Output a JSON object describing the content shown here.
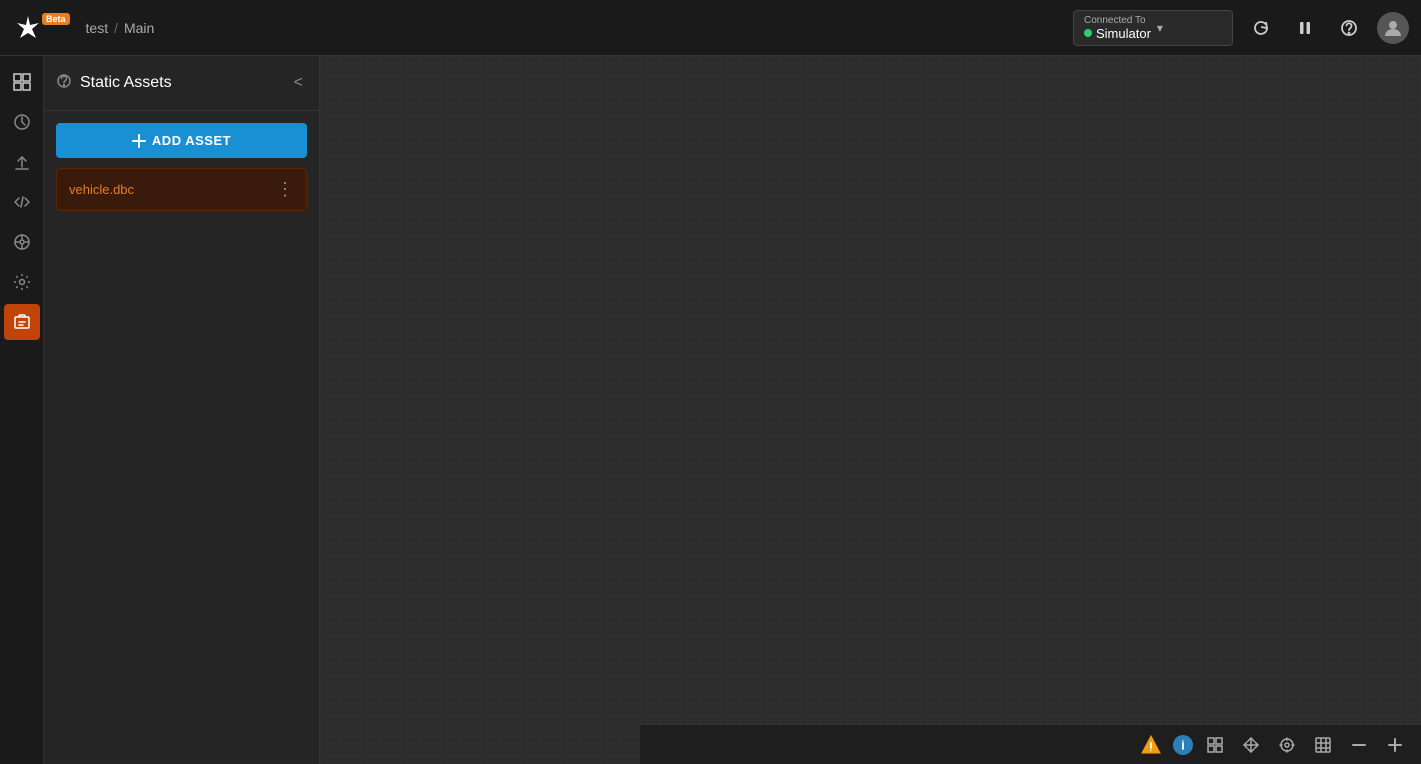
{
  "topbar": {
    "logo_symbol": "✦",
    "beta_label": "Beta",
    "breadcrumb_project": "test",
    "breadcrumb_separator": "/",
    "breadcrumb_page": "Main",
    "connection_label_top": "Connected To",
    "connection_label_bottom": "Simulator",
    "icons": {
      "refresh": "⟳",
      "pause": "⏸",
      "help": "?",
      "user": "👤"
    }
  },
  "icon_nav": {
    "items": [
      {
        "id": "layout",
        "symbol": "⊞",
        "active": false
      },
      {
        "id": "history",
        "symbol": "⟲",
        "active": false
      },
      {
        "id": "upload",
        "symbol": "⬆",
        "active": false
      },
      {
        "id": "code",
        "symbol": "{ }",
        "active": false
      },
      {
        "id": "extension",
        "symbol": "⊕",
        "active": false
      },
      {
        "id": "settings",
        "symbol": "⚙",
        "active": false
      },
      {
        "id": "asset",
        "symbol": "🗂",
        "active": true
      }
    ]
  },
  "side_panel": {
    "title": "Static Assets",
    "help_icon": "?",
    "collapse_icon": "<",
    "add_asset_button": "+ ADD ASSET",
    "assets": [
      {
        "name": "vehicle.dbc"
      }
    ]
  },
  "status_bar": {
    "warning_color": "#f39c12",
    "info_color": "#2980b9",
    "icons": [
      "ℹ",
      "⊟",
      "⊕",
      "⊕",
      "⊞",
      "−",
      "+"
    ]
  }
}
